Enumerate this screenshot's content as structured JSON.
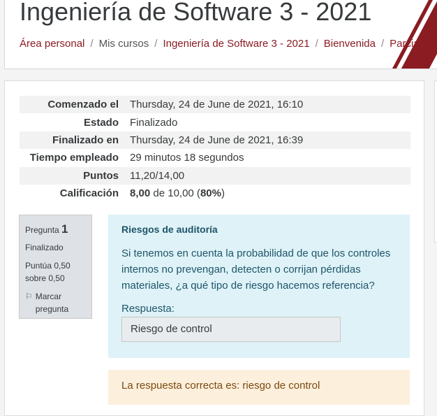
{
  "page": {
    "title": "Ingeniería de Software 3 - 2021",
    "breadcrumb": [
      "Área personal",
      "Mis cursos",
      "Ingeniería de Software 3 - 2021",
      "Bienvenida",
      "Parcial"
    ]
  },
  "summary": {
    "rows": [
      {
        "label": "Comenzado el",
        "value": "Thursday, 24 de June de 2021, 16:10"
      },
      {
        "label": "Estado",
        "value": "Finalizado"
      },
      {
        "label": "Finalizado en",
        "value": "Thursday, 24 de June de 2021, 16:39"
      },
      {
        "label": "Tiempo empleado",
        "value": "29 minutos 18 segundos"
      },
      {
        "label": "Puntos",
        "value": "11,20/14,00"
      }
    ],
    "grade_label": "Calificación",
    "grade_value": "8,00",
    "grade_of": "de 10,00 (",
    "grade_percent": "80%",
    "grade_close": ")"
  },
  "question": {
    "label": "Pregunta",
    "number": "1",
    "state": "Finalizado",
    "grade_text": "Puntúa 0,50 sobre 0,50",
    "flag_label": "Marcar pregunta",
    "title": "Riesgos de auditoría",
    "text": "Si tenemos en cuenta la probabilidad de que los controles internos no prevengan, detecten o corrijan pérdidas materiales, ¿a qué tipo de riesgo hacemos referencia?",
    "answer_label": "Respuesta:",
    "answer_value": "Riesgo de control",
    "feedback": "La respuesta correcta es: riesgo de control"
  },
  "colors": {
    "brand": "#8a1c22",
    "info_bg": "#def2f8",
    "feedback_bg": "#fcefdc"
  }
}
